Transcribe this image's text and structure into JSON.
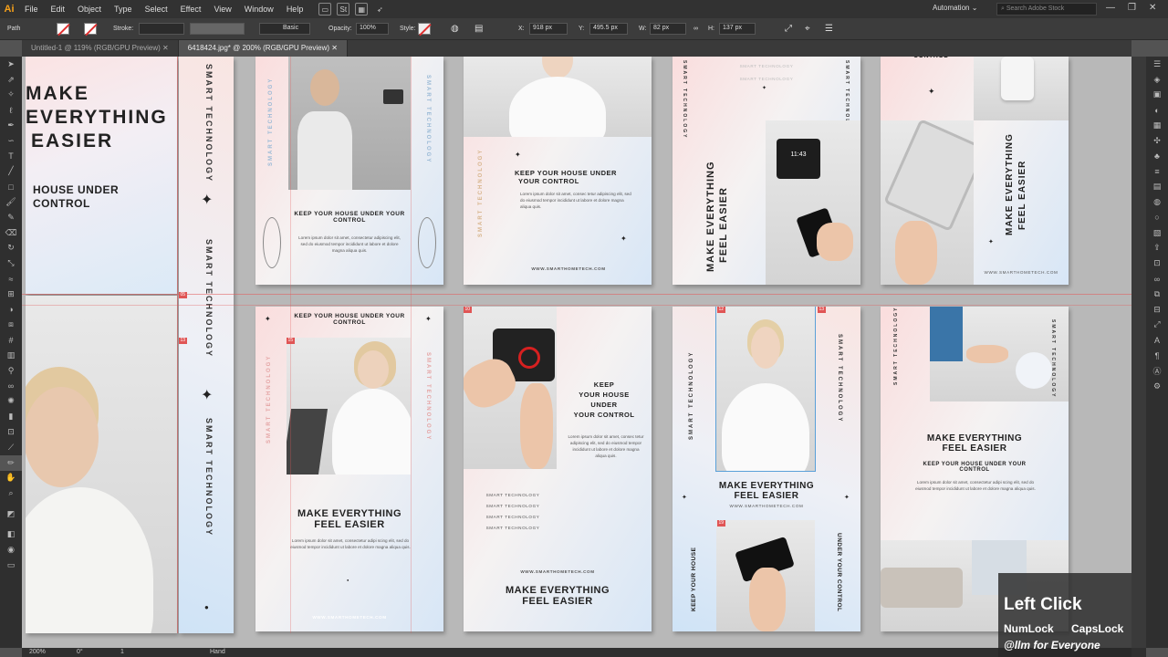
{
  "app": {
    "logo": "Ai",
    "workspace": "Automation",
    "search_placeholder": "Search Adobe Stock"
  },
  "menu": [
    "File",
    "Edit",
    "Object",
    "Type",
    "Select",
    "Effect",
    "View",
    "Window",
    "Help"
  ],
  "control": {
    "selection": "Path",
    "stroke_label": "Stroke:",
    "brush": "Basic",
    "opacity_label": "Opacity:",
    "opacity": "100%",
    "style_label": "Style:",
    "x_label": "X:",
    "x": "918 px",
    "y_label": "Y:",
    "y": "495.5 px",
    "w_label": "W:",
    "w": "82 px",
    "h_label": "H:",
    "h": "137 px"
  },
  "tabs": [
    "Untitled-1 @ 119% (RGB/GPU Preview)",
    "6418424.jpg* @ 200% (RGB/GPU Preview)"
  ],
  "status": {
    "zoom": "200%",
    "rotation": "0°",
    "artboard": "1",
    "tool": "Hand"
  },
  "texts": {
    "make": "MAKE",
    "everything": "EVERYTHING",
    "easier": "EASIER",
    "house_under": "HOUSE UNDER",
    "control": "CONTROL",
    "smart_tech": "SMART TECHNOLOGY",
    "keep_house": "KEEP YOUR HOUSE UNDER YOUR CONTROL",
    "keep_your_house_under": "KEEP YOUR HOUSE UNDER",
    "your_control": "YOUR CONTROL",
    "make_everything_feel_easier": "MAKE EVERYTHING FEEL EASIER",
    "make_everything": "MAKE EVERYTHING",
    "feel_easier": "FEEL EASIER",
    "keep": "KEEP",
    "your_house": "YOUR HOUSE",
    "under": "UNDER",
    "keep_your_house": "KEEP YOUR HOUSE",
    "under_your_control": "UNDER YOUR CONTROL",
    "lorem1": "Lorem ipsum dolor sit amet, consectetur adipiscing elit, sed do eiusmod tempor incididunt ut labore et dolore magna aliqua quis.",
    "lorem2": "Lorem ipsum dolor sit amet, consectetur adipi scing elit, sed do eiusmod tempor incididunt ut labore et dolore magna aliqua quis.",
    "lorem3": "Lorem ipsum dolor sit amet, consec tetur adipiscing elit, sed do eiusmod tempor incididunt ut labore et dolore magna aliqua quis.",
    "website": "WWW.SMARTHOMETECH.COM",
    "clock": "11:43"
  },
  "overlay": {
    "title": "Left Click",
    "numlock": "NumLock",
    "capslock": "CapsLock",
    "credit": "@llm for Everyone"
  }
}
